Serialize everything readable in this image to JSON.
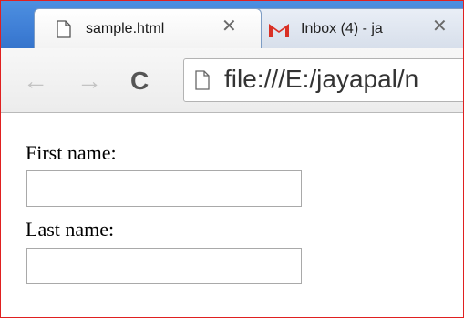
{
  "tabs": [
    {
      "label": "sample.html",
      "close": "✕"
    },
    {
      "label": "Inbox (4) - ja",
      "close": "✕"
    }
  ],
  "toolbar": {
    "back_glyph": "←",
    "forward_glyph": "→",
    "reload_glyph": "C",
    "url": "file:///E:/jayapal/n"
  },
  "form": {
    "first_name_label": "First name:",
    "first_name_value": "",
    "last_name_label": "Last name:",
    "last_name_value": ""
  },
  "colors": {
    "frame_border": "#e02020",
    "gmail_red": "#d93025"
  }
}
